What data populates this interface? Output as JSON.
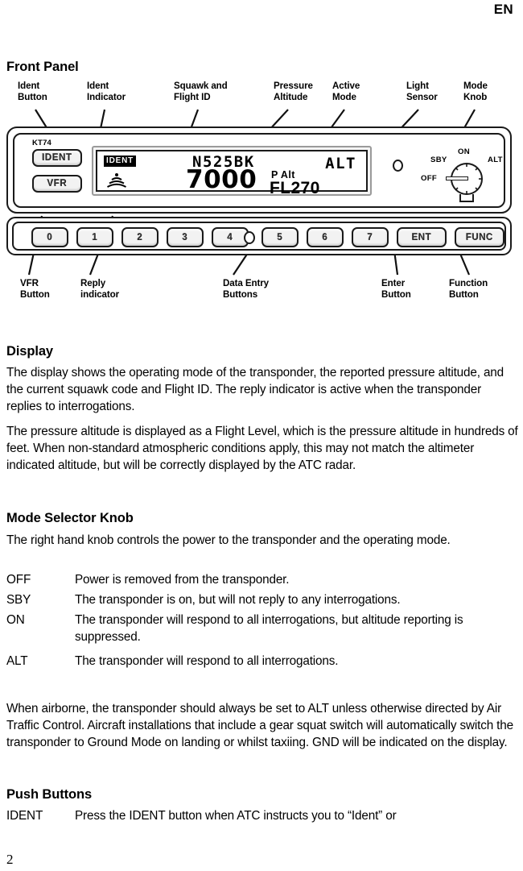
{
  "page": {
    "language_tag": "EN",
    "page_number": "2"
  },
  "front_panel": {
    "heading": "Front Panel",
    "callouts_top": [
      {
        "id": "ident-button",
        "text": "Ident\nButton"
      },
      {
        "id": "ident-indicator",
        "text": "Ident\nIndicator"
      },
      {
        "id": "squawk-flight-id",
        "text": "Squawk and\nFlight ID"
      },
      {
        "id": "pressure-altitude",
        "text": "Pressure\nAltitude"
      },
      {
        "id": "active-mode",
        "text": "Active\nMode"
      },
      {
        "id": "light-sensor",
        "text": "Light\nSensor"
      },
      {
        "id": "mode-knob",
        "text": "Mode\nKnob"
      }
    ],
    "callouts_bottom": [
      {
        "id": "vfr-button",
        "text": "VFR\nButton"
      },
      {
        "id": "reply-indicator",
        "text": "Reply\nindicator"
      },
      {
        "id": "data-entry",
        "text": "Data Entry\nButtons"
      },
      {
        "id": "enter-button",
        "text": "Enter\nButton"
      },
      {
        "id": "function-button",
        "text": "Function\nButton"
      }
    ],
    "device": {
      "model": "KT74",
      "ident_button": "IDENT",
      "vfr_button": "VFR",
      "display": {
        "ident_indicator": "IDENT",
        "reply_indicator_icon": "radio-waves-icon",
        "flight_id": "N525BK",
        "squawk": "7000",
        "pressure_alt_label": "P Alt",
        "pressure_alt_value": "FL270",
        "active_mode": "ALT"
      },
      "light_sensor_icon": "light-sensor-icon",
      "mode_knob": {
        "positions": [
          "OFF",
          "SBY",
          "ON",
          "ALT"
        ],
        "selected": "OFF"
      },
      "keys": [
        "0",
        "1",
        "2",
        "3",
        "4",
        "5",
        "6",
        "7"
      ],
      "enter_key": "ENT",
      "function_key": "FUNC"
    }
  },
  "display_section": {
    "heading": "Display",
    "paragraph_1": "The display shows the operating mode of the transponder, the reported pressure altitude, and the current squawk code and Flight ID.  The reply indicator is active when the transponder replies to interrogations.",
    "paragraph_2": "The pressure altitude is displayed as a Flight Level, which is the pressure altitude in hundreds of feet.  When non-standard atmospheric conditions apply, this may not match the altimeter indicated altitude, but will be correctly displayed by the ATC radar."
  },
  "mode_selector_section": {
    "heading": "Mode Selector Knob",
    "intro": "The right hand knob controls the power to the transponder and the operating mode.",
    "modes": [
      {
        "term": "OFF",
        "desc": "Power is removed from the transponder."
      },
      {
        "term": "SBY",
        "desc": "The transponder is on, but will not reply to any interrogations."
      },
      {
        "term": "ON",
        "desc": "The transponder will respond to all interrogations, but altitude reporting is suppressed."
      },
      {
        "term": "ALT",
        "desc": "The transponder will respond to all interrogations."
      }
    ],
    "note": "When airborne, the transponder should always be set to ALT unless otherwise directed by Air Traffic Control.  Aircraft installations that include a gear squat switch will automatically switch the transponder to Ground Mode on landing or whilst taxiing. GND will be indicated on the display."
  },
  "push_buttons_section": {
    "heading": "Push Buttons",
    "items": [
      {
        "term": "IDENT",
        "desc": "Press the IDENT button when ATC instructs you to “Ident” or"
      }
    ]
  }
}
